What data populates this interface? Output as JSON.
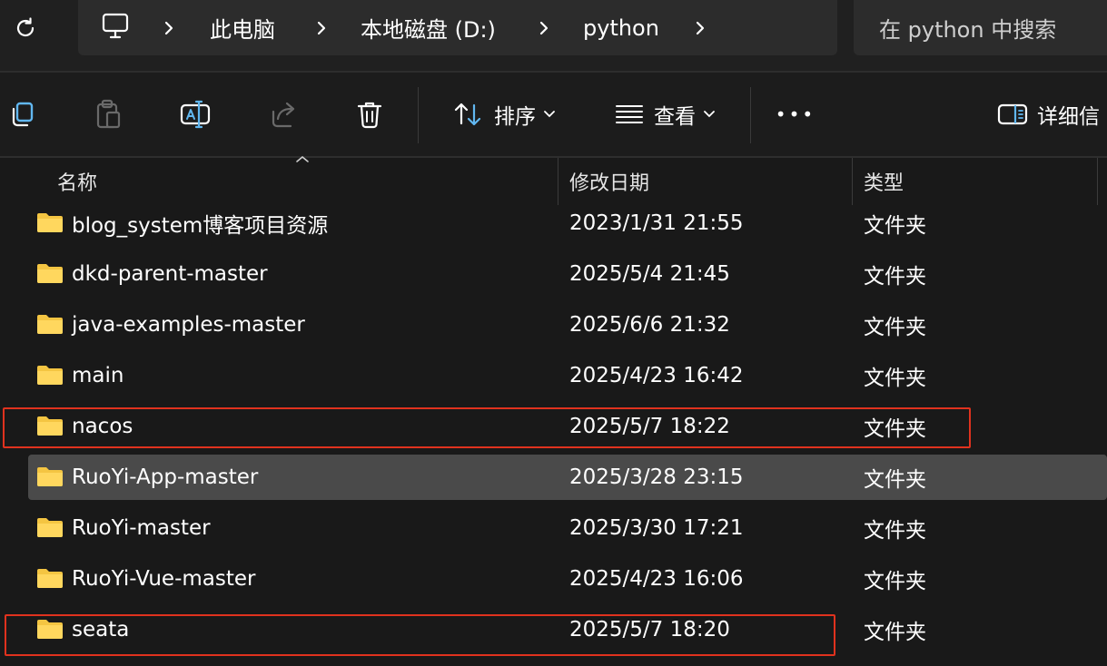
{
  "address_bar": {
    "crumbs": [
      "此电脑",
      "本地磁盘 (D:)",
      "python"
    ]
  },
  "search": {
    "placeholder": "在 python 中搜索"
  },
  "toolbar": {
    "sort_label": "排序",
    "view_label": "查看",
    "more_label": "•••",
    "details_label": "详细信"
  },
  "columns": {
    "name": "名称",
    "modified": "修改日期",
    "type": "类型"
  },
  "files": [
    {
      "name": "blog_system博客项目资源",
      "modified": "2023/1/31 21:55",
      "type": "文件夹"
    },
    {
      "name": "dkd-parent-master",
      "modified": "2025/5/4 21:45",
      "type": "文件夹"
    },
    {
      "name": "java-examples-master",
      "modified": "2025/6/6 21:32",
      "type": "文件夹"
    },
    {
      "name": "main",
      "modified": "2025/4/23 16:42",
      "type": "文件夹"
    },
    {
      "name": "nacos",
      "modified": "2025/5/7 18:22",
      "type": "文件夹"
    },
    {
      "name": "RuoYi-App-master",
      "modified": "2025/3/28 23:15",
      "type": "文件夹"
    },
    {
      "name": "RuoYi-master",
      "modified": "2025/3/30 17:21",
      "type": "文件夹"
    },
    {
      "name": "RuoYi-Vue-master",
      "modified": "2025/4/23 16:06",
      "type": "文件夹"
    },
    {
      "name": "seata",
      "modified": "2025/5/7 18:20",
      "type": "文件夹"
    }
  ],
  "colors": {
    "background": "#191919",
    "selected_row": "#4a4a4a",
    "highlight_border": "#e0321e",
    "folder": "#f4c542",
    "accent_icon": "#61b7f0"
  }
}
